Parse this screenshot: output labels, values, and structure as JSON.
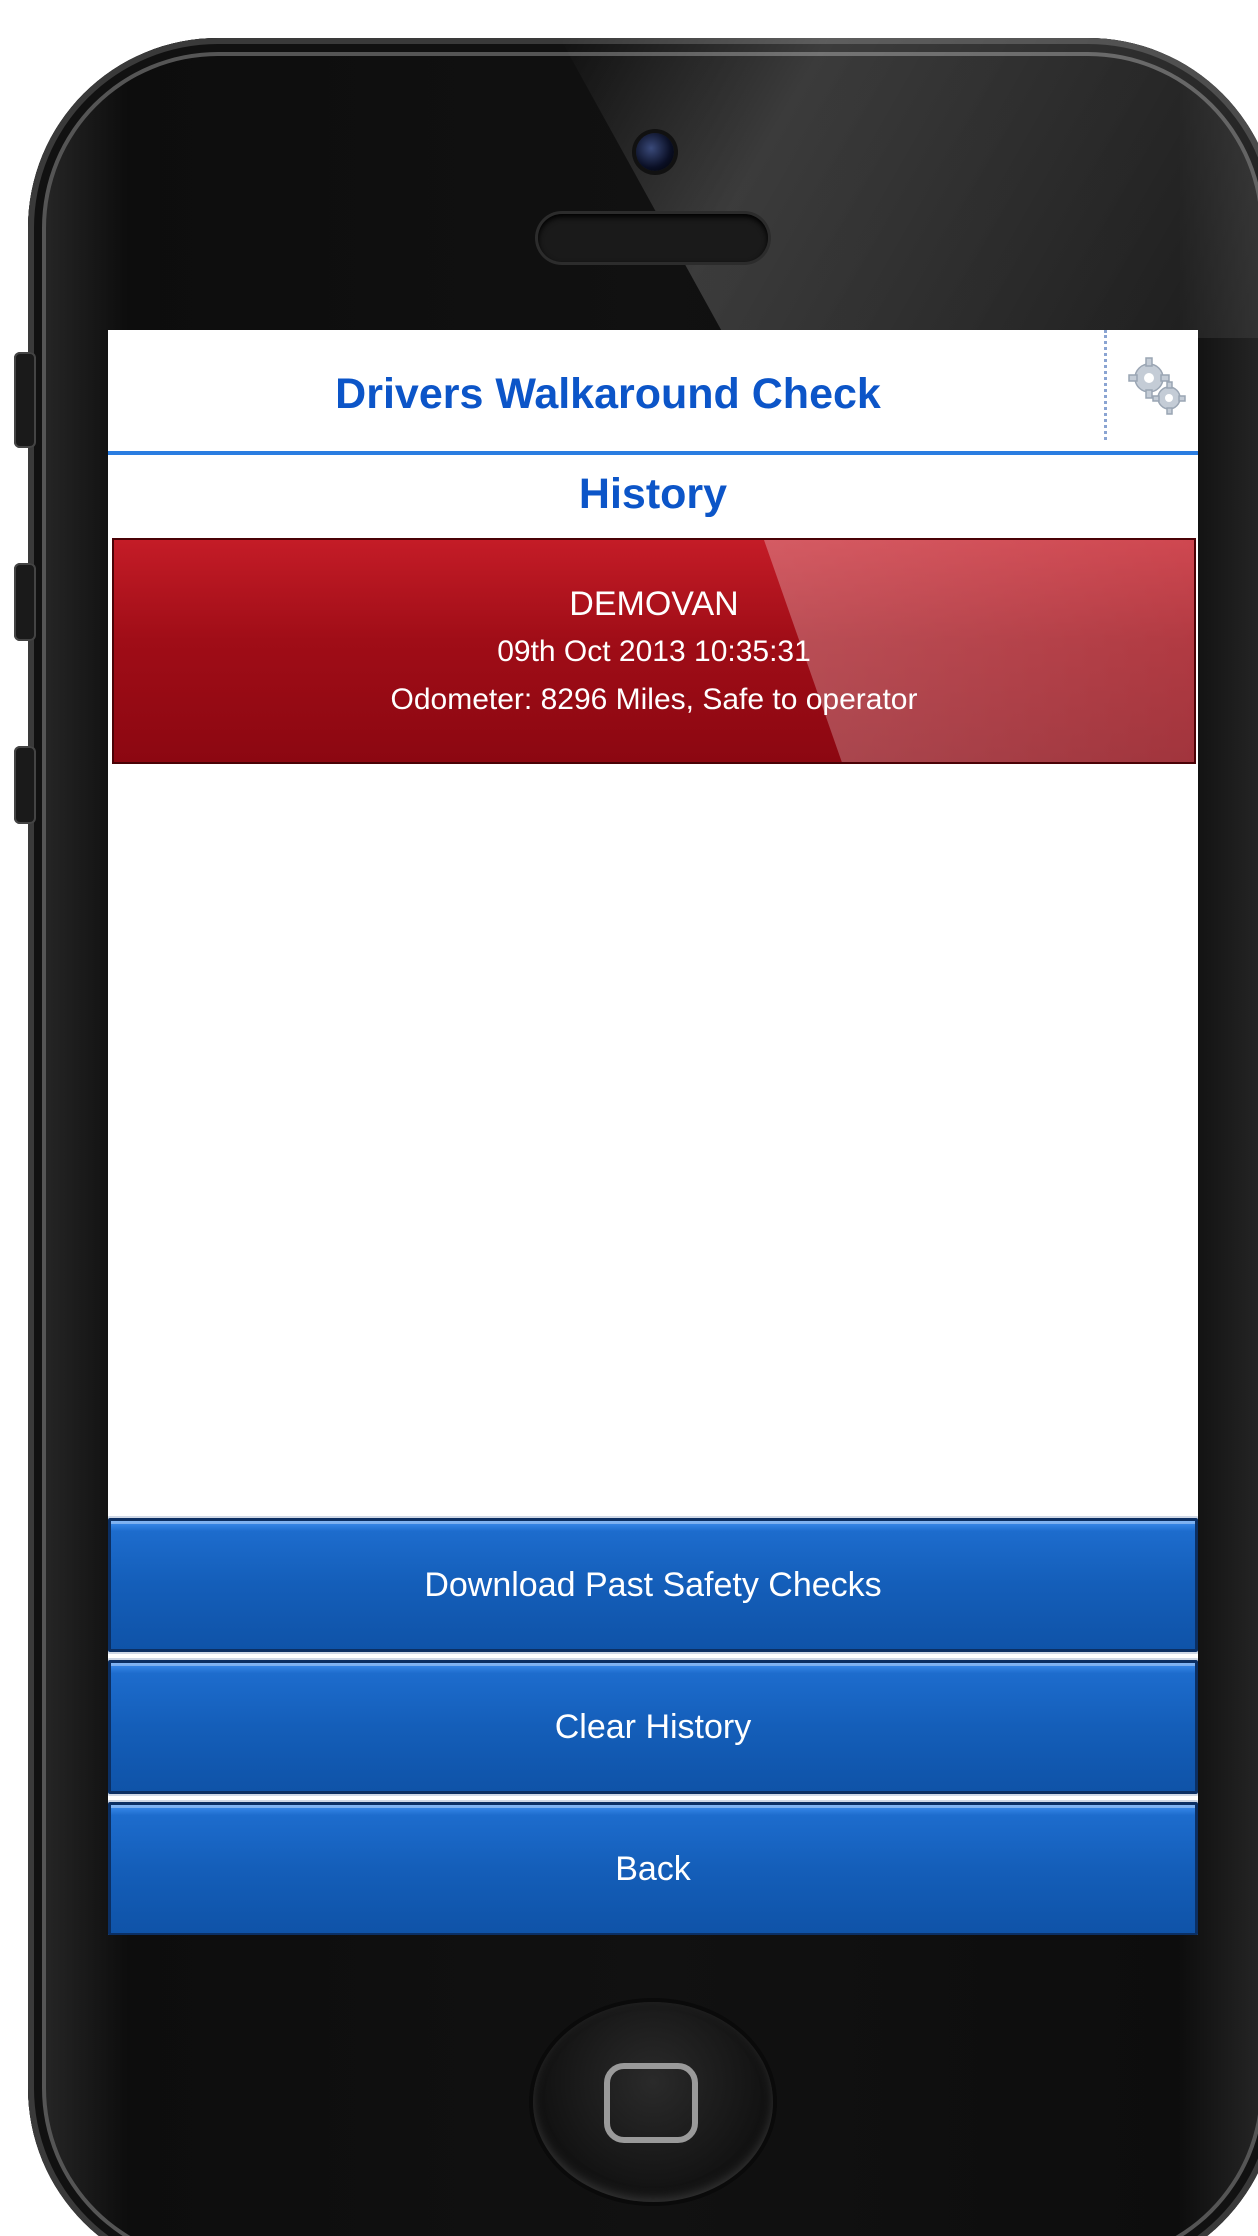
{
  "header": {
    "title": "Drivers Walkaround Check",
    "settings_icon": "gear-icon"
  },
  "page": {
    "title": "History"
  },
  "history": [
    {
      "vehicle": "DEMOVAN",
      "datetime": "09th Oct 2013 10:35:31",
      "summary": "Odometer: 8296 Miles, Safe to operator",
      "status_color": "#a00d17"
    }
  ],
  "actions": {
    "download_label": "Download Past Safety Checks",
    "clear_label": "Clear History",
    "back_label": "Back"
  },
  "colors": {
    "accent": "#0c55c8",
    "button_blue": "#145eb9",
    "history_red": "#a00d17"
  }
}
